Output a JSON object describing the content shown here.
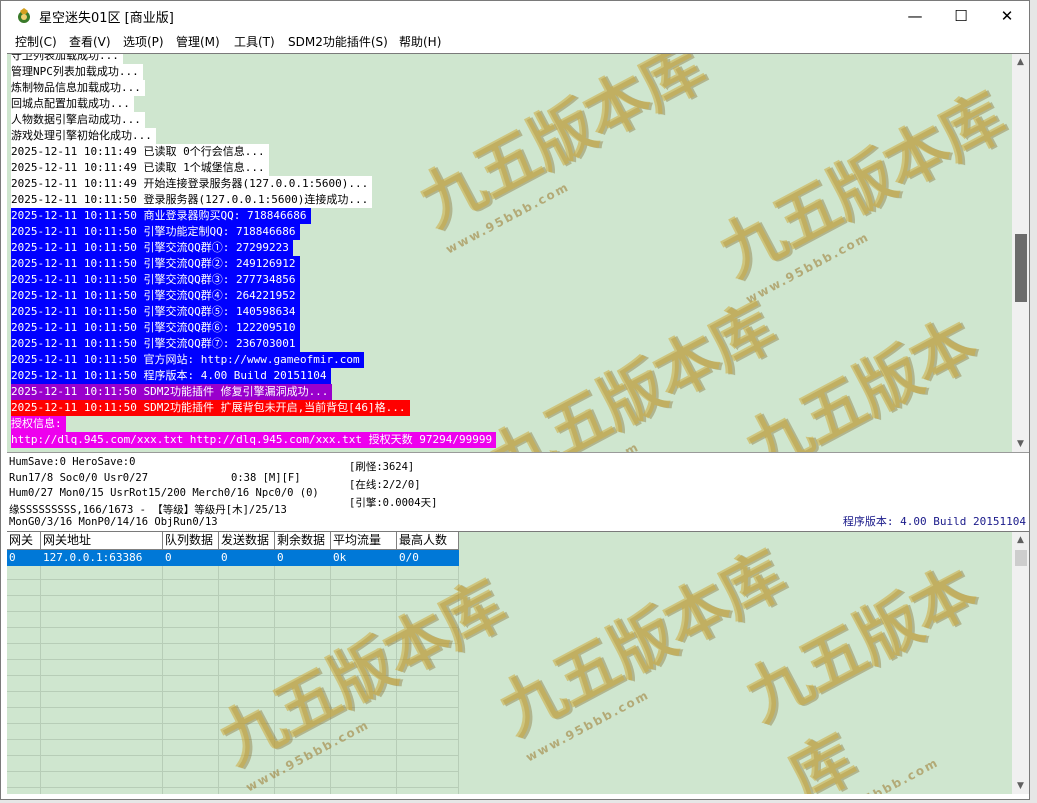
{
  "window": {
    "title": "星空迷失01区 [商业版]",
    "minimize": "—",
    "maximize": "☐",
    "close": "✕"
  },
  "menu": [
    {
      "label": "控制(C)"
    },
    {
      "label": "查看(V)"
    },
    {
      "label": "选项(P)"
    },
    {
      "label": "管理(M)"
    },
    {
      "label": "工具(T)"
    },
    {
      "label": "SDM2功能插件(S)"
    },
    {
      "label": "帮助(H)"
    }
  ],
  "log": [
    {
      "text": "守卫列表加载成功...",
      "bg": "#ffffff",
      "fg": "#000000"
    },
    {
      "text": "管理NPC列表加载成功...",
      "bg": "#ffffff",
      "fg": "#000000"
    },
    {
      "text": "炼制物品信息加载成功...",
      "bg": "#ffffff",
      "fg": "#000000"
    },
    {
      "text": "回城点配置加载成功...",
      "bg": "#ffffff",
      "fg": "#000000"
    },
    {
      "text": "人物数据引擎启动成功...",
      "bg": "#ffffff",
      "fg": "#000000"
    },
    {
      "text": "游戏处理引擎初始化成功...",
      "bg": "#ffffff",
      "fg": "#000000"
    },
    {
      "text": "2025-12-11 10:11:49 已读取 0个行会信息...",
      "bg": "#ffffff",
      "fg": "#000000"
    },
    {
      "text": "2025-12-11 10:11:49 已读取 1个城堡信息...",
      "bg": "#ffffff",
      "fg": "#000000"
    },
    {
      "text": "2025-12-11 10:11:49 开始连接登录服务器(127.0.0.1:5600)...",
      "bg": "#ffffff",
      "fg": "#000000"
    },
    {
      "text": "2025-12-11 10:11:50 登录服务器(127.0.0.1:5600)连接成功...",
      "bg": "#ffffff",
      "fg": "#000000"
    },
    {
      "text": "2025-12-11 10:11:50 商业登录器购买QQ: 718846686",
      "bg": "#0000ff",
      "fg": "#ffffff"
    },
    {
      "text": "2025-12-11 10:11:50 引擎功能定制QQ: 718846686",
      "bg": "#0000ff",
      "fg": "#ffffff"
    },
    {
      "text": "2025-12-11 10:11:50 引擎交流QQ群①: 27299223",
      "bg": "#0000ff",
      "fg": "#ffffff"
    },
    {
      "text": "2025-12-11 10:11:50 引擎交流QQ群②: 249126912",
      "bg": "#0000ff",
      "fg": "#ffffff"
    },
    {
      "text": "2025-12-11 10:11:50 引擎交流QQ群③: 277734856",
      "bg": "#0000ff",
      "fg": "#ffffff"
    },
    {
      "text": "2025-12-11 10:11:50 引擎交流QQ群④: 264221952",
      "bg": "#0000ff",
      "fg": "#ffffff"
    },
    {
      "text": "2025-12-11 10:11:50 引擎交流QQ群⑤: 140598634",
      "bg": "#0000ff",
      "fg": "#ffffff"
    },
    {
      "text": "2025-12-11 10:11:50 引擎交流QQ群⑥: 122209510",
      "bg": "#0000ff",
      "fg": "#ffffff"
    },
    {
      "text": "2025-12-11 10:11:50 引擎交流QQ群⑦: 236703001",
      "bg": "#0000ff",
      "fg": "#ffffff"
    },
    {
      "text": "2025-12-11 10:11:50 官方网站: http://www.gameofmir.com",
      "bg": "#0000ff",
      "fg": "#ffffff"
    },
    {
      "text": "2025-12-11 10:11:50 程序版本: 4.00 Build 20151104",
      "bg": "#0000ff",
      "fg": "#ffffff"
    },
    {
      "text": "2025-12-11 10:11:50 SDM2功能插件 修复引擎漏洞成功...",
      "bg": "#9900cc",
      "fg": "#ffffff"
    },
    {
      "text": "2025-12-11 10:11:50 SDM2功能插件 扩展背包未开启,当前背包[46]格...",
      "bg": "#ff0000",
      "fg": "#ffffff"
    },
    {
      "text": "授权信息:",
      "bg": "#ee00ee",
      "fg": "#ffffff"
    },
    {
      "text": "http://dlq.945.com/xxx.txt http://dlq.945.com/xxx.txt 授权天数 97294/99999",
      "bg": "#ee00ee",
      "fg": "#ffffff"
    }
  ],
  "status": {
    "line1": "HumSave:0 HeroSave:0",
    "line2": "Run17/8 Soc0/0 Usr0/27",
    "line3": "Hum0/27 Mon0/15 UsrRot15/200 Merch0/16 Npc0/0 (0)",
    "line4": "缘SSSSSSSSS,166/1673 - 【等级】等级丹[木]/25/13",
    "line5": "MonG0/3/16 MonP0/14/16 ObjRun0/13",
    "timer": "0:38 [M][F]",
    "refresh": "[刷怪:3624]",
    "online": "[在线:2/2/0]",
    "engine": "[引擎:0.0004天]",
    "version": "程序版本: 4.00 Build 20151104"
  },
  "gate_table": {
    "headers": [
      "网关",
      "网关地址",
      "队列数据",
      "发送数据",
      "剩余数据",
      "平均流量",
      "最高人数"
    ],
    "rows": [
      [
        "0",
        "127.0.0.1:63386",
        "0",
        "0",
        "0",
        "0k",
        "0/0"
      ]
    ]
  },
  "watermark": {
    "text": "九五版本库",
    "url": "www.95bbb.com"
  }
}
